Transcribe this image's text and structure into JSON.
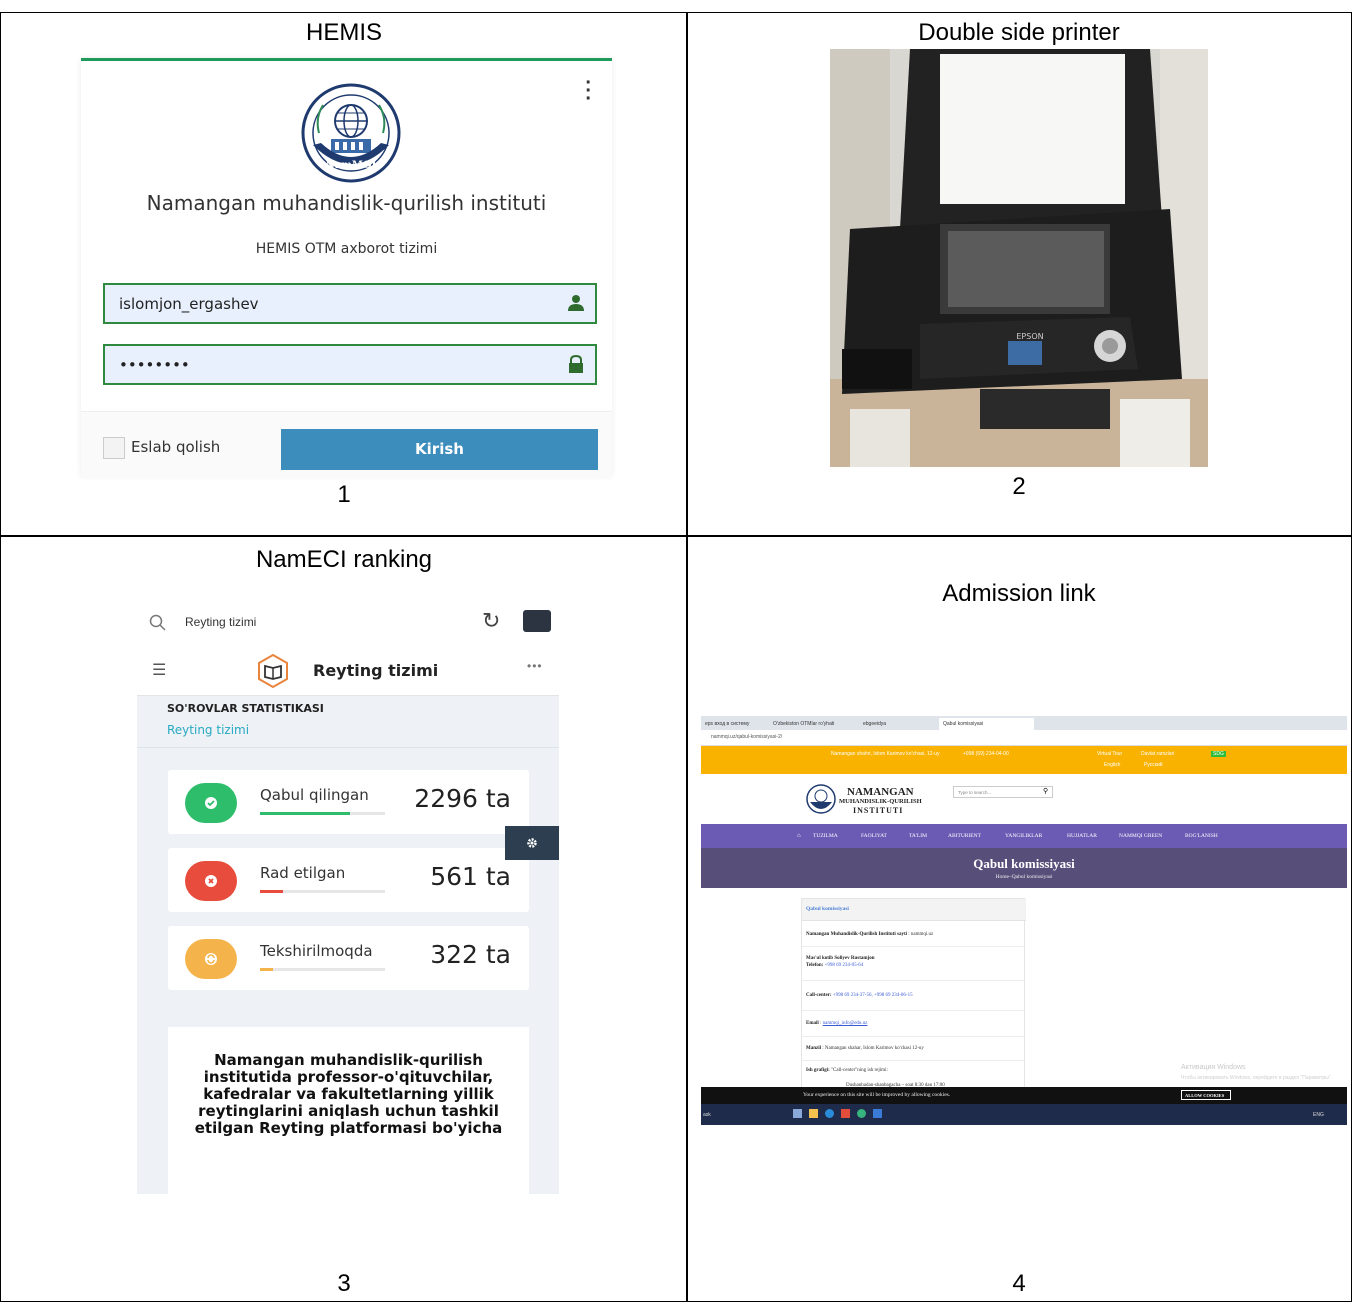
{
  "panels": {
    "p1": {
      "title": "HEMIS",
      "number": "1"
    },
    "p2": {
      "title": "Double side printer",
      "number": "2"
    },
    "p3": {
      "title": "NamECI ranking",
      "number": "3"
    },
    "p4": {
      "title": "Admission link",
      "number": "4"
    }
  },
  "hemis": {
    "institute": "Namangan muhandislik-qurilish instituti",
    "subtitle": "HEMIS OTM axborot tizimi",
    "username": "islomjon_ergashev",
    "password": "••••••••",
    "remember_label": "Eslab qolish",
    "login_label": "Kirish",
    "logo_text": "NamMQI"
  },
  "printer": {
    "brand": "EPSON"
  },
  "ranking": {
    "search_text": "Reyting tizimi",
    "header_title": "Reyting tizimi",
    "section_title": "SO'ROVLAR STATISTIKASI",
    "section_link": "Reyting tizimi",
    "stats": [
      {
        "label": "Qabul qilingan",
        "value": "2296 ta",
        "progress": 0.72,
        "color": "#2ebd6b"
      },
      {
        "label": "Rad etilgan",
        "value": "561 ta",
        "progress": 0.18,
        "color": "#e74c3c"
      },
      {
        "label": "Tekshirilmoqda",
        "value": "322 ta",
        "progress": 0.1,
        "color": "#f5b44b"
      }
    ],
    "paragraph": "Namangan muhandislik-qurilish institutida professor-o'qituvchilar, kafedralar va fakultetlarning yillik reytinglarini aniqlash uchun tashkil etilgan Reyting platformasi bo'yicha"
  },
  "admission": {
    "tabs": [
      "eps вход в систему",
      "O'zbekiston OTMlar ro'yhati",
      "ebgeeidya",
      "Qabul komissiyasi"
    ],
    "url": "nammqi.uz/qabul-komissiyasi-2/",
    "top_address": "Namangan shahri, Islom Karimov ko'chasi, 12-uy",
    "top_phone": "+998 (69) 234-04-00",
    "top_links": [
      "Virtual Tour",
      "Davlat ramzlari",
      "SDG"
    ],
    "languages": [
      "English",
      "Русский"
    ],
    "logo_name1": "NAMANGAN",
    "logo_name2": "MUHANDISLIK-QURILISH",
    "logo_name3": "INSTITUTI",
    "search_placeholder": "Type to search...",
    "nav": [
      "TUZILMA",
      "FAOLIYAT",
      "TA'LIM",
      "ABITURIENT",
      "YANGILIKLAR",
      "HUJJATLAR",
      "NAMMQI GREEN",
      "BOG'LANISH"
    ],
    "banner_title": "Qabul komissiyasi",
    "breadcrumb": "Home–Qabul komissiyasi",
    "content_title": "Qabul komissiyasi",
    "site_label": "Namangan Muhandislik-Qurilish Instituti sayti",
    "site_value": ": nammqi.uz",
    "secretary_label": "Mas'ul kotib Soliyev Rustamjon",
    "phone_label": "Telefon:",
    "phone_value": "+998 69 234-05-64",
    "callcenter_label": "Call-center:",
    "callcenter_value": "+998 69 234-37-56,  +998 69 234-06-15",
    "email_label": "Email",
    "email_value": "nammqi_info@edu.uz",
    "address_label": "Manzil",
    "address_value": ": Namangan shahar, Islom Karimov ko'chasi 12-uy",
    "schedule_label": "Ish grafigi:",
    "schedule_value": "\"Call-center\"ning ish rejimi:",
    "schedule_hours": "Dushanbadan-shanbagacha – soat 8:30 dan 17:00",
    "cookie_text": "Your experience on this site will be improved by allowing cookies.",
    "cookie_button": "ALLOW COOKIES",
    "watermark1": "Активация Windows",
    "watermark2": "Чтобы активировать Windows, перейдите в раздел \"Параметры\".",
    "taskbar_search": "ask",
    "taskbar_lang": "ENG"
  }
}
